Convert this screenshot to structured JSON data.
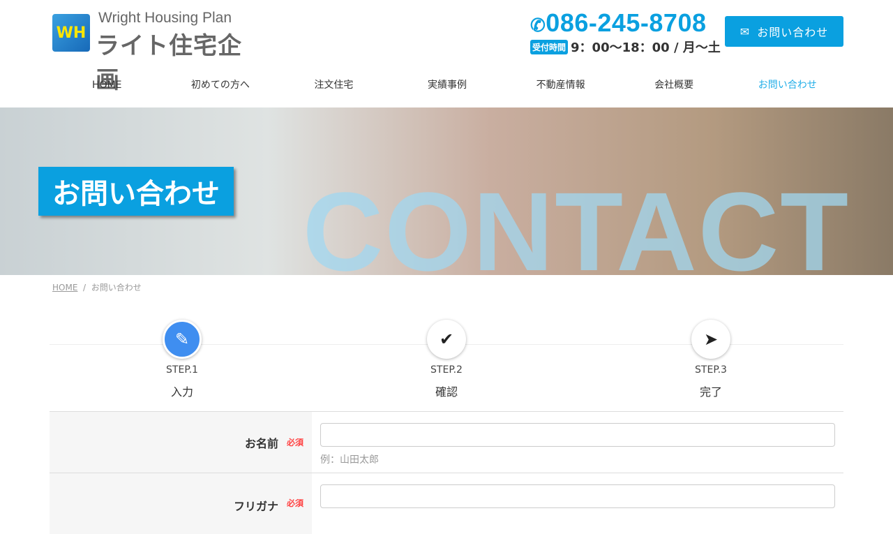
{
  "header": {
    "logo_mark": "WH",
    "logo_en": "Wright Housing Plan",
    "logo_jp": "ライト住宅企画",
    "phone": "086-245-8708",
    "hours_tag": "受付時間",
    "hours": "9：00～18：00 / 月～土",
    "contact_button": "お問い合わせ"
  },
  "nav": [
    "HOME",
    "初めての方へ",
    "注文住宅",
    "実績事例",
    "不動産情報",
    "会社概要",
    "お問い合わせ"
  ],
  "hero": {
    "title": "お問い合わせ",
    "background_word": "CONTACT"
  },
  "breadcrumb": {
    "home": "HOME",
    "sep": "/",
    "current": "お問い合わせ"
  },
  "steps": [
    {
      "step": "STEP.1",
      "label": "入力",
      "icon": "pencil-icon"
    },
    {
      "step": "STEP.2",
      "label": "確認",
      "icon": "check-icon"
    },
    {
      "step": "STEP.3",
      "label": "完了",
      "icon": "paper-plane-icon"
    }
  ],
  "form": {
    "required": "必須",
    "fields": [
      {
        "label": "お名前",
        "value": "",
        "hint": "例：山田太郎"
      },
      {
        "label": "フリガナ",
        "value": ""
      }
    ]
  },
  "colors": {
    "accent": "#0aa0e0",
    "step_active": "#3f8ef0",
    "required": "#ff4444"
  }
}
